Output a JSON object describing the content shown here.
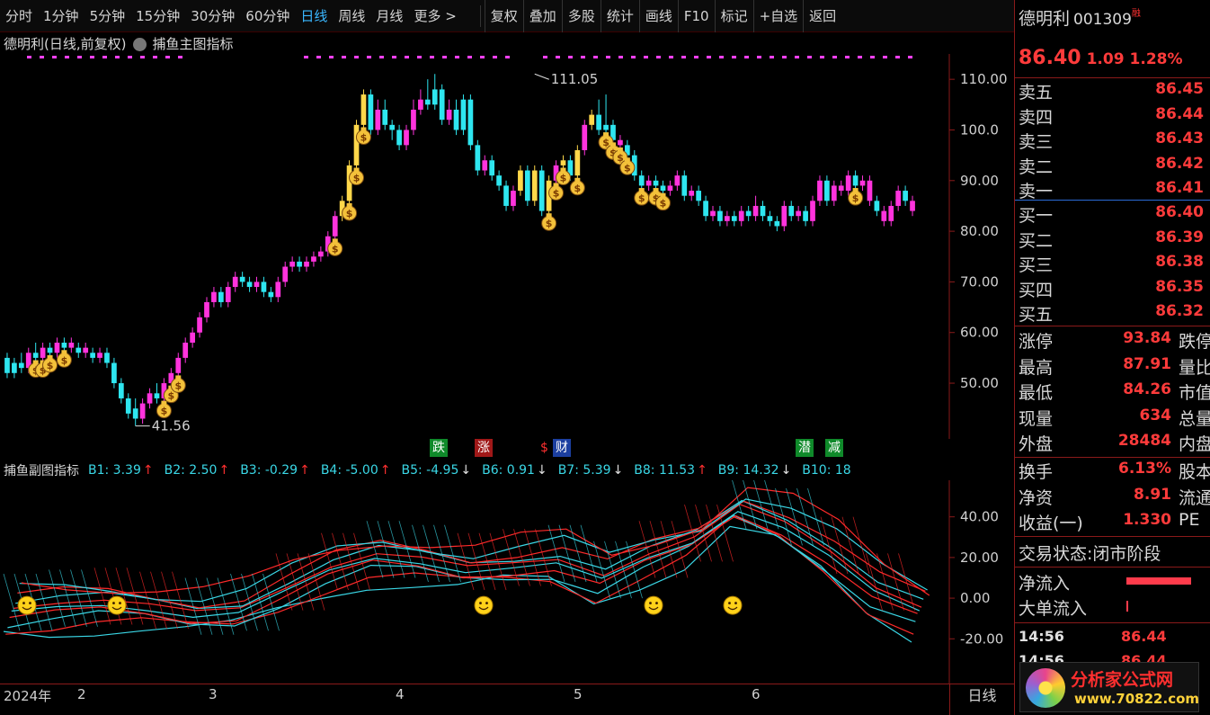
{
  "toolbar": {
    "periods": [
      "分时",
      "1分钟",
      "5分钟",
      "15分钟",
      "30分钟",
      "60分钟",
      "日线",
      "周线",
      "月线",
      "更多 >"
    ],
    "active_period": "日线",
    "tools": [
      "复权",
      "叠加",
      "多股",
      "统计",
      "画线",
      "F10",
      "标记",
      "+自选",
      "返回"
    ]
  },
  "main_header": {
    "stock_label": "德明利(日线,前复权)",
    "indicator": "捕鱼主图指标"
  },
  "sub_header": {
    "indicator": "捕鱼副图指标",
    "items": [
      {
        "label": "B1: 3.39",
        "arrow": "↑",
        "dir": "up"
      },
      {
        "label": "B2: 2.50",
        "arrow": "↑",
        "dir": "up"
      },
      {
        "label": "B3: -0.29",
        "arrow": "↑",
        "dir": "up"
      },
      {
        "label": "B4: -5.00",
        "arrow": "↑",
        "dir": "up"
      },
      {
        "label": "B5: -4.95",
        "arrow": "↓",
        "dir": "down"
      },
      {
        "label": "B6: 0.91",
        "arrow": "↓",
        "dir": "down"
      },
      {
        "label": "B7: 5.39",
        "arrow": "↓",
        "dir": "down"
      },
      {
        "label": "B8: 11.53",
        "arrow": "↑",
        "dir": "up"
      },
      {
        "label": "B9: 14.32",
        "arrow": "↓",
        "dir": "down"
      },
      {
        "label": "B10: 18",
        "arrow": "",
        "dir": "none"
      }
    ]
  },
  "signals": [
    {
      "text": "跌",
      "color": "#0f8a2a",
      "x": 478
    },
    {
      "text": "涨",
      "color": "#a01818",
      "x": 528
    },
    {
      "text": "$",
      "color": "#000",
      "x": 598
    },
    {
      "text": "财",
      "color": "#1c3fa0",
      "x": 615
    },
    {
      "text": "潜",
      "color": "#0f8a2a",
      "x": 885
    },
    {
      "text": "减",
      "color": "#0f8a2a",
      "x": 918
    }
  ],
  "dates": [
    {
      "label": "2024年",
      "x": 4
    },
    {
      "label": "2",
      "x": 86
    },
    {
      "label": "3",
      "x": 232
    },
    {
      "label": "4",
      "x": 440
    },
    {
      "label": "5",
      "x": 638
    },
    {
      "label": "6",
      "x": 836
    }
  ],
  "period_label": "日线",
  "chart_data": [
    {
      "type": "candlestick",
      "title": "捕鱼主图指标",
      "ylim": [
        39,
        115
      ],
      "y_ticks": [
        "110.00",
        "100.0",
        "90.00",
        "80.00",
        "70.00",
        "60.00",
        "50.00"
      ],
      "y_tick_values": [
        110,
        100,
        90,
        80,
        70,
        60,
        50
      ],
      "annotations": [
        {
          "label": "111.05",
          "value": 111.05,
          "index": 74
        },
        {
          "label": "41.56",
          "value": 41.56,
          "index": 18
        }
      ],
      "candles": [
        [
          55,
          52,
          56,
          51,
          "c"
        ],
        [
          52,
          54,
          55,
          51,
          "c"
        ],
        [
          54,
          53,
          56,
          52,
          "c"
        ],
        [
          53,
          56,
          57,
          52,
          "m"
        ],
        [
          56,
          55,
          58,
          54,
          "c"
        ],
        [
          55,
          57,
          58,
          54,
          "m"
        ],
        [
          57,
          56,
          58,
          55,
          "c"
        ],
        [
          56,
          58,
          59,
          55,
          "m"
        ],
        [
          58,
          57,
          59,
          56,
          "c"
        ],
        [
          57,
          58,
          59,
          56,
          "m"
        ],
        [
          57,
          56,
          58,
          55,
          "c"
        ],
        [
          56,
          57,
          58,
          55,
          "m"
        ],
        [
          56,
          55,
          57,
          54,
          "c"
        ],
        [
          55,
          56,
          57,
          54,
          "m"
        ],
        [
          56,
          54,
          57,
          53,
          "c"
        ],
        [
          54,
          50,
          55,
          49,
          "c"
        ],
        [
          50,
          47,
          51,
          46,
          "c"
        ],
        [
          47,
          44,
          48,
          43,
          "c"
        ],
        [
          45,
          43,
          47,
          41.56,
          "c"
        ],
        [
          43,
          46,
          47,
          42,
          "m"
        ],
        [
          46,
          48,
          49,
          45,
          "m"
        ],
        [
          48,
          47,
          50,
          46,
          "c"
        ],
        [
          47,
          50,
          51,
          46,
          "m"
        ],
        [
          50,
          52,
          53,
          49,
          "m"
        ],
        [
          52,
          55,
          56,
          51,
          "m"
        ],
        [
          55,
          58,
          59,
          54,
          "m"
        ],
        [
          58,
          60,
          61,
          57,
          "m"
        ],
        [
          60,
          63,
          64,
          59,
          "m"
        ],
        [
          63,
          66,
          67,
          62,
          "m"
        ],
        [
          66,
          68,
          69,
          65,
          "m"
        ],
        [
          68,
          66,
          69,
          65,
          "c"
        ],
        [
          66,
          69,
          70,
          65,
          "m"
        ],
        [
          69,
          71,
          72,
          68,
          "m"
        ],
        [
          71,
          70,
          72,
          69,
          "c"
        ],
        [
          70,
          69,
          71,
          68,
          "c"
        ],
        [
          69,
          70,
          71,
          68,
          "m"
        ],
        [
          70,
          68,
          71,
          67,
          "c"
        ],
        [
          68,
          67,
          69,
          66,
          "c"
        ],
        [
          67,
          70,
          71,
          66,
          "m"
        ],
        [
          70,
          73,
          74,
          69,
          "m"
        ],
        [
          73,
          74,
          75,
          72,
          "m"
        ],
        [
          74,
          73,
          75,
          72,
          "c"
        ],
        [
          73,
          74,
          75,
          72,
          "m"
        ],
        [
          74,
          75,
          76,
          73,
          "m"
        ],
        [
          75,
          76,
          77,
          74,
          "m"
        ],
        [
          76,
          79,
          80,
          75,
          "m"
        ],
        [
          79,
          83,
          84,
          78,
          "m"
        ],
        [
          83,
          86,
          87,
          82,
          "y"
        ],
        [
          86,
          93,
          94,
          85,
          "y"
        ],
        [
          93,
          101,
          102,
          92,
          "y"
        ],
        [
          101,
          107,
          108,
          100,
          "y"
        ],
        [
          107,
          100,
          108,
          99,
          "c"
        ],
        [
          100,
          104,
          106,
          99,
          "m"
        ],
        [
          104,
          101,
          106,
          100,
          "c"
        ],
        [
          101,
          100,
          102,
          98,
          "c"
        ],
        [
          100,
          97,
          101,
          96,
          "c"
        ],
        [
          97,
          100,
          101,
          96,
          "m"
        ],
        [
          100,
          104,
          106,
          99,
          "m"
        ],
        [
          104,
          106,
          108,
          103,
          "m"
        ],
        [
          106,
          105,
          110,
          104,
          "c"
        ],
        [
          105,
          108,
          111.05,
          104,
          "c"
        ],
        [
          108,
          102,
          109,
          101,
          "c"
        ],
        [
          102,
          104,
          106,
          101,
          "m"
        ],
        [
          104,
          100,
          106,
          99,
          "c"
        ],
        [
          100,
          106,
          107,
          99,
          "c"
        ],
        [
          106,
          97,
          107,
          96,
          "c"
        ],
        [
          97,
          92,
          98,
          91,
          "c"
        ],
        [
          92,
          94,
          95,
          91,
          "m"
        ],
        [
          94,
          91,
          95,
          90,
          "c"
        ],
        [
          91,
          89,
          92,
          88,
          "c"
        ],
        [
          89,
          85,
          90,
          84,
          "c"
        ],
        [
          85,
          88,
          89,
          84,
          "m"
        ],
        [
          88,
          92,
          93,
          87,
          "y"
        ],
        [
          92,
          86,
          93,
          85,
          "c"
        ],
        [
          86,
          92,
          93,
          85,
          "y"
        ],
        [
          92,
          84,
          93,
          83,
          "c"
        ],
        [
          84,
          90,
          91,
          83,
          "y"
        ],
        [
          90,
          93,
          94,
          89,
          "m"
        ],
        [
          93,
          94,
          95,
          92,
          "y"
        ],
        [
          94,
          91,
          95,
          90,
          "c"
        ],
        [
          91,
          96,
          97,
          90,
          "y"
        ],
        [
          96,
          101,
          102,
          95,
          "m"
        ],
        [
          101,
          103,
          104,
          100,
          "y"
        ],
        [
          103,
          100,
          106,
          99,
          "c"
        ],
        [
          100,
          101,
          107,
          99,
          "c"
        ],
        [
          101,
          98,
          102,
          97,
          "c"
        ],
        [
          98,
          97,
          99,
          96,
          "m"
        ],
        [
          97,
          95,
          98,
          94,
          "c"
        ],
        [
          95,
          91,
          96,
          90,
          "c"
        ],
        [
          91,
          89,
          92,
          88,
          "c"
        ],
        [
          89,
          90,
          91,
          88,
          "m"
        ],
        [
          90,
          89,
          91,
          88,
          "c"
        ],
        [
          89,
          88,
          90,
          87,
          "c"
        ],
        [
          88,
          89,
          90,
          87,
          "m"
        ],
        [
          89,
          91,
          92,
          88,
          "m"
        ],
        [
          91,
          87,
          92,
          86,
          "c"
        ],
        [
          87,
          88,
          89,
          86,
          "m"
        ],
        [
          88,
          86,
          89,
          85,
          "c"
        ],
        [
          86,
          83,
          87,
          82,
          "c"
        ],
        [
          83,
          84,
          85,
          82,
          "m"
        ],
        [
          84,
          82,
          85,
          81,
          "c"
        ],
        [
          82,
          83,
          84,
          81,
          "m"
        ],
        [
          83,
          82,
          84,
          81,
          "c"
        ],
        [
          82,
          84,
          85,
          81,
          "m"
        ],
        [
          84,
          83,
          85,
          82,
          "c"
        ],
        [
          83,
          85,
          87,
          82,
          "m"
        ],
        [
          85,
          83,
          86,
          82,
          "c"
        ],
        [
          83,
          82,
          84,
          81,
          "c"
        ],
        [
          82,
          81,
          83,
          80,
          "c"
        ],
        [
          81,
          85,
          86,
          80,
          "m"
        ],
        [
          85,
          83,
          86,
          82,
          "c"
        ],
        [
          83,
          84,
          85,
          82,
          "m"
        ],
        [
          84,
          82,
          85,
          81,
          "c"
        ],
        [
          82,
          86,
          87,
          81,
          "m"
        ],
        [
          86,
          90,
          91,
          85,
          "m"
        ],
        [
          90,
          86,
          91,
          85,
          "c"
        ],
        [
          86,
          89,
          90,
          85,
          "m"
        ],
        [
          89,
          88,
          90,
          87,
          "m"
        ],
        [
          88,
          91,
          92,
          87,
          "m"
        ],
        [
          91,
          89,
          92,
          88,
          "c"
        ],
        [
          89,
          90,
          91,
          88,
          "m"
        ],
        [
          90,
          86,
          91,
          85,
          "m"
        ],
        [
          86,
          84,
          87,
          83,
          "c"
        ],
        [
          84,
          82,
          85,
          81,
          "m"
        ],
        [
          82,
          85,
          86,
          81,
          "m"
        ],
        [
          85,
          88,
          89,
          84,
          "m"
        ],
        [
          88,
          86,
          89,
          85,
          "c"
        ],
        [
          86,
          84,
          87,
          83,
          "m"
        ]
      ],
      "money_markers": [
        4,
        5,
        6,
        8,
        22,
        23,
        24,
        46,
        48,
        49,
        50,
        76,
        77,
        78,
        80,
        84,
        85,
        86,
        87,
        89,
        91,
        92,
        119,
        130,
        140
      ]
    },
    {
      "type": "line",
      "title": "捕鱼副图指标",
      "ylim": [
        -42,
        58
      ],
      "y_ticks": [
        "40.00",
        "20.00",
        "0.00",
        "-20.00"
      ],
      "y_tick_values": [
        40,
        20,
        0,
        -20
      ],
      "series_count": 10,
      "x": [
        0,
        10,
        20,
        30,
        40,
        50,
        60,
        70,
        80,
        90,
        100,
        110,
        120,
        130,
        140,
        150,
        160,
        170,
        180,
        190,
        200
      ],
      "base": [
        -2,
        0,
        1,
        -1,
        -4,
        -2,
        8,
        18,
        24,
        22,
        18,
        20,
        22,
        14,
        24,
        32,
        48,
        40,
        26,
        8,
        -2
      ],
      "smiley_positions": [
        30,
        130,
        538,
        727,
        815
      ]
    }
  ],
  "panel": {
    "name": "德明利",
    "code": "001309",
    "sup": "融",
    "price": "86.40",
    "change": "1.09",
    "pct": "1.28%",
    "asks": [
      {
        "label": "卖五",
        "value": "86.45"
      },
      {
        "label": "卖四",
        "value": "86.44"
      },
      {
        "label": "卖三",
        "value": "86.43"
      },
      {
        "label": "卖二",
        "value": "86.42"
      },
      {
        "label": "卖一",
        "value": "86.41"
      }
    ],
    "bids": [
      {
        "label": "买一",
        "value": "86.40"
      },
      {
        "label": "买二",
        "value": "86.39"
      },
      {
        "label": "买三",
        "value": "86.38"
      },
      {
        "label": "买四",
        "value": "86.35"
      },
      {
        "label": "买五",
        "value": "86.32"
      }
    ],
    "stats": [
      {
        "label": "涨停",
        "value": "93.84",
        "color": "red",
        "label2": "跌停"
      },
      {
        "label": "最高",
        "value": "87.91",
        "color": "red",
        "label2": "量比"
      },
      {
        "label": "最低",
        "value": "84.26",
        "color": "green",
        "label2": "市值"
      },
      {
        "label": "现量",
        "value": "634",
        "color": "mag",
        "label2": "总量"
      },
      {
        "label": "外盘",
        "value": "28484",
        "color": "red",
        "label2": "内盘"
      }
    ],
    "stats2": [
      {
        "label": "换手",
        "value": "6.13%",
        "label2": "股本"
      },
      {
        "label": "净资",
        "value": "8.91",
        "label2": "流通"
      },
      {
        "label": "收益(一)",
        "value": "1.330",
        "label2": "PE"
      }
    ],
    "trade_status": "交易状态:闭市阶段",
    "net_inflow_label": "净流入",
    "big_inflow_label": "大单流入",
    "ticks": [
      {
        "time": "14:56",
        "price": "86.44"
      },
      {
        "time": "14:56",
        "price": "86.44"
      }
    ]
  },
  "logo": {
    "title": "分析家公式网",
    "url": "www.70822.com"
  }
}
